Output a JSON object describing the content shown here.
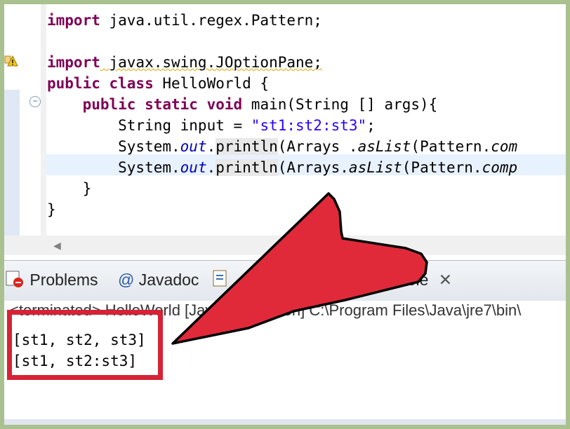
{
  "editor": {
    "code_lines": [
      {
        "parts": [
          {
            "t": "import",
            "c": "kw"
          },
          {
            "t": " java.util.regex.Pattern;",
            "c": ""
          }
        ]
      },
      {
        "parts": [
          {
            "t": "import",
            "c": "kw"
          },
          {
            "t": " javax.swing.JOptionPane;",
            "c": "squiggle"
          }
        ]
      },
      {
        "parts": [
          {
            "t": "public class",
            "c": "kw"
          },
          {
            "t": " HelloWorld {",
            "c": ""
          }
        ]
      },
      {
        "parts": [
          {
            "t": "    ",
            "c": ""
          },
          {
            "t": "public static void",
            "c": "kw"
          },
          {
            "t": " main(String [] args){",
            "c": ""
          }
        ]
      },
      {
        "parts": [
          {
            "t": "        String input = ",
            "c": ""
          },
          {
            "t": "\"st1:st2:st3\"",
            "c": "str"
          },
          {
            "t": ";",
            "c": ""
          }
        ]
      },
      {
        "parts": [
          {
            "t": "        System.",
            "c": ""
          },
          {
            "t": "out",
            "c": "fld"
          },
          {
            "t": ".",
            "c": ""
          },
          {
            "t": "println",
            "c": "sel"
          },
          {
            "t": "(Arrays .",
            "c": ""
          },
          {
            "t": "asList",
            "c": "ital"
          },
          {
            "t": "(Pattern.",
            "c": ""
          },
          {
            "t": "com",
            "c": "ital"
          }
        ]
      },
      {
        "parts": [
          {
            "t": "        System.",
            "c": ""
          },
          {
            "t": "out",
            "c": "fld"
          },
          {
            "t": ".",
            "c": ""
          },
          {
            "t": "println",
            "c": "sel"
          },
          {
            "t": "(Arrays.",
            "c": ""
          },
          {
            "t": "asList",
            "c": "ital"
          },
          {
            "t": "(Pattern.",
            "c": ""
          },
          {
            "t": "comp",
            "c": "ital"
          }
        ]
      },
      {
        "parts": [
          {
            "t": "    }",
            "c": ""
          }
        ]
      },
      {
        "parts": [
          {
            "t": "}",
            "c": ""
          }
        ]
      }
    ]
  },
  "tabs": {
    "problems": "Problems",
    "javadoc": "Javadoc",
    "console": "Console"
  },
  "console": {
    "status": "<terminated> HelloWorld [Java Application] C:\\Program Files\\Java\\jre7\\bin\\",
    "output": [
      "[st1, st2, st3]",
      "[st1, st2:st3]"
    ]
  },
  "icons": [
    "warning-icon",
    "collapse-icon",
    "problems-icon",
    "javadoc-icon",
    "declaration-icon",
    "close-icon",
    "scroll-left-icon"
  ],
  "colors": {
    "arrow": "#e02a3a",
    "highlight": "#d62236",
    "keyword": "#7f0055",
    "string": "#2a00ff",
    "field": "#0000c0"
  }
}
